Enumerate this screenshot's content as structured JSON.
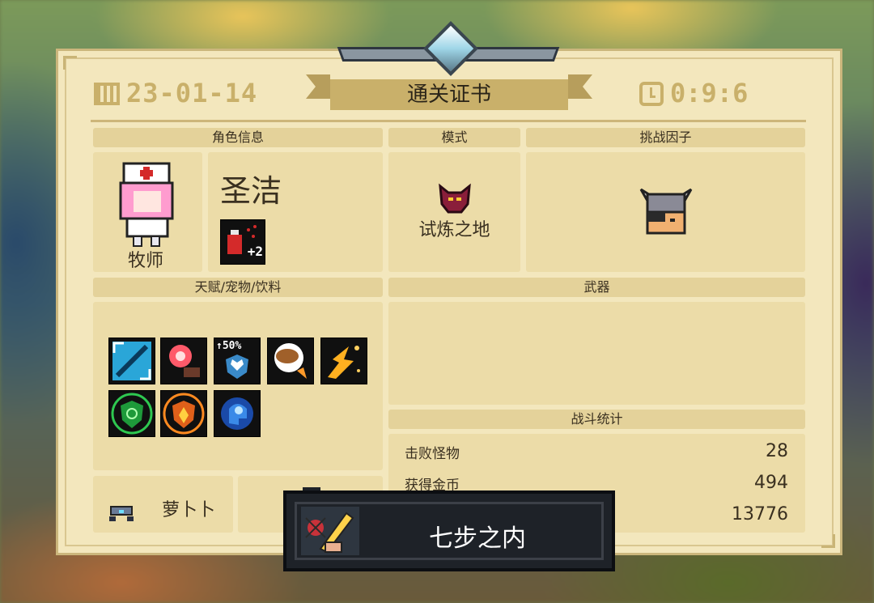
{
  "header": {
    "date": "23-01-14",
    "title": "通关证书",
    "time": "0:9:6"
  },
  "sections": {
    "character_info": "角色信息",
    "mode": "模式",
    "challenge_factor": "挑战因子",
    "talents": "天赋/宠物/饮料",
    "weapon": "武器",
    "battle_stats": "战斗统计"
  },
  "character": {
    "name": "圣洁",
    "class": "牧师",
    "buff_badge": "+2"
  },
  "mode": {
    "name": "试炼之地"
  },
  "talents": {
    "icons": [
      "speed-blade-icon",
      "red-orb-icon",
      "heart-shield-icon",
      "meat-drumstick-icon",
      "explosion-spark-icon",
      "green-shield-icon",
      "orange-shield-icon",
      "blue-brain-icon"
    ],
    "badge_label": "↑50%"
  },
  "pet": {
    "name": "萝卜卜"
  },
  "stats": [
    {
      "label": "击败怪物",
      "value": "28"
    },
    {
      "label": "获得金币",
      "value": "494"
    },
    {
      "label": "",
      "value": "13776"
    }
  ],
  "weapon_popup": {
    "name": "七步之内"
  },
  "colors": {
    "card_bg": "#f3e7bd",
    "header_bg": "#e4d29a",
    "gold": "#c9b06a",
    "popup_bg": "#1e2228"
  }
}
